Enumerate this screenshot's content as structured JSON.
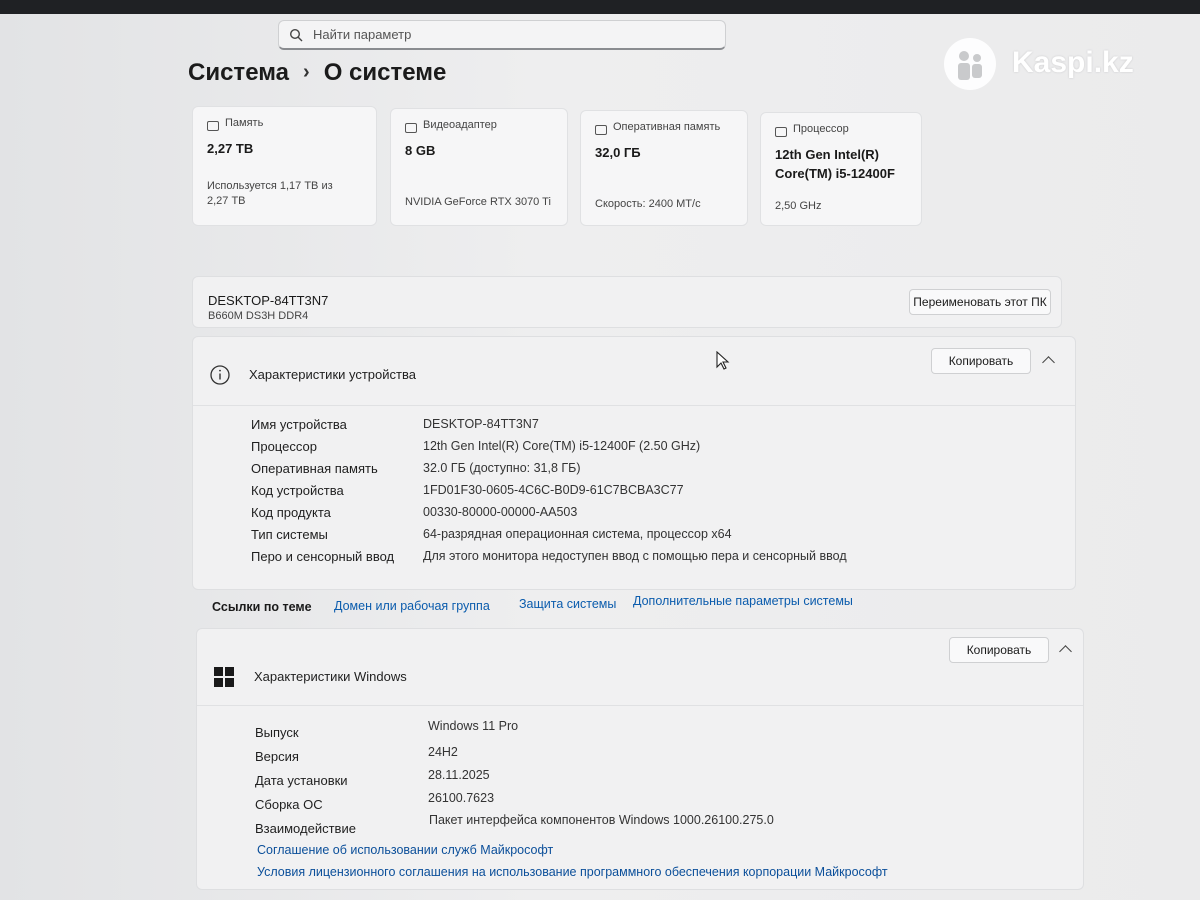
{
  "search": {
    "placeholder": "Найти параметр"
  },
  "breadcrumb": {
    "parent": "Система",
    "separator": "›",
    "current": "О системе"
  },
  "watermark": {
    "text": "Kaspi.kz"
  },
  "summary_cards": [
    {
      "label": "Память",
      "value": "2,27 TB",
      "sub": "Используется 1,17 TB из 2,27 TB",
      "icon": "storage-icon"
    },
    {
      "label": "Видеоадаптер",
      "value": "8 GB",
      "sub": "NVIDIA GeForce RTX 3070 Ti",
      "icon": "gpu-icon"
    },
    {
      "label": "Оперативная память",
      "value": "32,0 ГБ",
      "sub": "Скорость: 2400 МТ/с",
      "icon": "ram-icon"
    },
    {
      "label": "Процессор",
      "value": "12th Gen Intel(R) Core(TM) i5-12400F",
      "sub": "2,50 GHz",
      "icon": "cpu-icon"
    }
  ],
  "device_name_panel": {
    "name": "DESKTOP-84TT3N7",
    "model": "B660M DS3H DDR4",
    "rename_button": "Переименовать этот ПК"
  },
  "device_specs": {
    "title": "Характеристики устройства",
    "copy_button": "Копировать",
    "rows": [
      {
        "label": "Имя устройства",
        "value": "DESKTOP-84TT3N7"
      },
      {
        "label": "Процессор",
        "value": "12th Gen Intel(R) Core(TM) i5-12400F (2.50 GHz)"
      },
      {
        "label": "Оперативная память",
        "value": "32.0 ГБ (доступно: 31,8 ГБ)"
      },
      {
        "label": "Код устройства",
        "value": "1FD01F30-0605-4C6C-B0D9-61C7BCBA3C77"
      },
      {
        "label": "Код продукта",
        "value": "00330-80000-00000-AA503"
      },
      {
        "label": "Тип системы",
        "value": "64-разрядная операционная система, процессор x64"
      },
      {
        "label": "Перо и сенсорный ввод",
        "value": "Для этого монитора недоступен ввод с помощью пера и сенсорный ввод"
      }
    ]
  },
  "related_links": {
    "title": "Ссылки по теме",
    "links": [
      "Домен или рабочая группа",
      "Защита системы",
      "Дополнительные параметры системы"
    ]
  },
  "windows_specs": {
    "title": "Характеристики Windows",
    "copy_button": "Копировать",
    "rows": [
      {
        "label": "Выпуск",
        "value": "Windows 11 Pro"
      },
      {
        "label": "Версия",
        "value": "24H2"
      },
      {
        "label": "Дата установки",
        "value": "28.11.2025"
      },
      {
        "label": "Сборка ОС",
        "value": "26100.7623"
      },
      {
        "label": "Взаимодействие",
        "value": "Пакет интерфейса компонентов Windows 1000.26100.275.0"
      }
    ],
    "footer_links": [
      "Соглашение об использовании служб Майкрософт",
      "Условия лицензионного соглашения на использование программного обеспечения корпорации Майкрософт"
    ]
  }
}
